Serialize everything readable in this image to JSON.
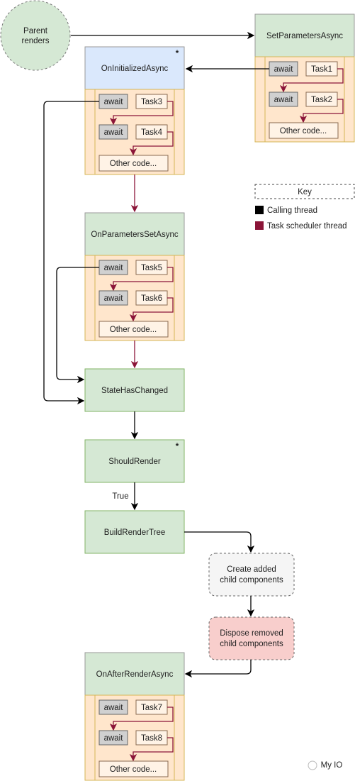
{
  "diagram": {
    "parent": "Parent renders",
    "set_parameters": {
      "title": "SetParametersAsync",
      "rows": [
        [
          "await",
          "Task1"
        ],
        [
          "await",
          "Task2"
        ]
      ],
      "other": "Other code..."
    },
    "on_initialized": {
      "title": "OnInitializedAsync",
      "star": "*",
      "rows": [
        [
          "await",
          "Task3"
        ],
        [
          "await",
          "Task4"
        ]
      ],
      "other": "Other code..."
    },
    "on_parameters_set": {
      "title": "OnParametersSetAsync",
      "rows": [
        [
          "await",
          "Task5"
        ],
        [
          "await",
          "Task6"
        ]
      ],
      "other": "Other code..."
    },
    "state_has_changed": "StateHasChanged",
    "should_render": {
      "title": "ShouldRender",
      "star": "*"
    },
    "true_label": "True",
    "build_render_tree": "BuildRenderTree",
    "create_children": [
      "Create added",
      "child components"
    ],
    "dispose_children": [
      "Dispose removed",
      "child components"
    ],
    "on_after_render": {
      "title": "OnAfterRenderAsync",
      "rows": [
        [
          "await",
          "Task7"
        ],
        [
          "await",
          "Task8"
        ]
      ],
      "other": "Other code..."
    },
    "key": {
      "title": "Key",
      "items": [
        {
          "label": "Calling thread",
          "color": "#000000"
        },
        {
          "label": "Task scheduler thread",
          "color": "#8b1538"
        }
      ]
    },
    "watermark": "My IO"
  },
  "colors": {
    "green": "#d5e8d4",
    "blue": "#dae8fc",
    "orange": "#ffe6cc",
    "grey": "#f5f5f5",
    "pink": "#f8cecc",
    "purple": "#8b1538"
  }
}
